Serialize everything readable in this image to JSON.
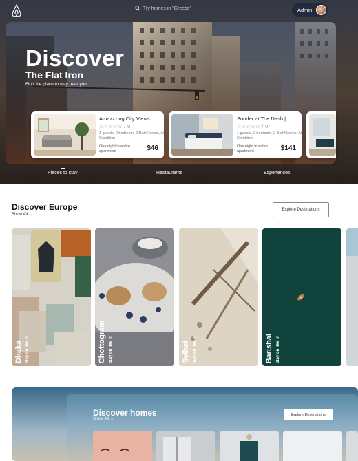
{
  "header": {
    "search_placeholder": "Try homes in \"Greece\"",
    "user_label": "Admin"
  },
  "hero": {
    "title": "Discover",
    "subtitle": "The Flat Iron",
    "tagline": "Find the place to stay near you",
    "tabs": [
      "Places to stay",
      "Restaurants",
      "Experiences"
    ],
    "listings": [
      {
        "title": "Amazzzing City Views...",
        "stars": "☆☆☆☆☆ / 0",
        "desc": "1 guests, 2 bedroom, 2 BathRooms, Air Condition",
        "night": "One night in entire apartment",
        "price": "$46"
      },
      {
        "title": "Sonder at The Nash |...",
        "stars": "☆☆☆☆☆ / 0",
        "desc": "1 guests, 2 bedroom, 2 BathRooms, Air Condition",
        "night": "One night in entire apartment",
        "price": "$141"
      }
    ]
  },
  "europe": {
    "title": "Discover Europe",
    "show_all": "Show All →",
    "explore_label": "Explore Destinations",
    "destinations": [
      {
        "name": "Dhaka",
        "stay": "Stay on like in"
      },
      {
        "name": "Chottogram",
        "stay": "Stay on like in"
      },
      {
        "name": "Sylhet",
        "stay": "Stay on like in"
      },
      {
        "name": "Barishal",
        "stay": "Stay on like in"
      }
    ]
  },
  "homes": {
    "title": "Discover homes",
    "show_all": "Show All →",
    "explore_label": "Explore Destinations"
  },
  "colors": {
    "accent_dark": "#1f2a44",
    "card_bg": "#ffffff"
  },
  "icons": {
    "logo": "airbnb-logo-icon",
    "search": "search-icon",
    "arrow": "arrow-right-icon"
  }
}
